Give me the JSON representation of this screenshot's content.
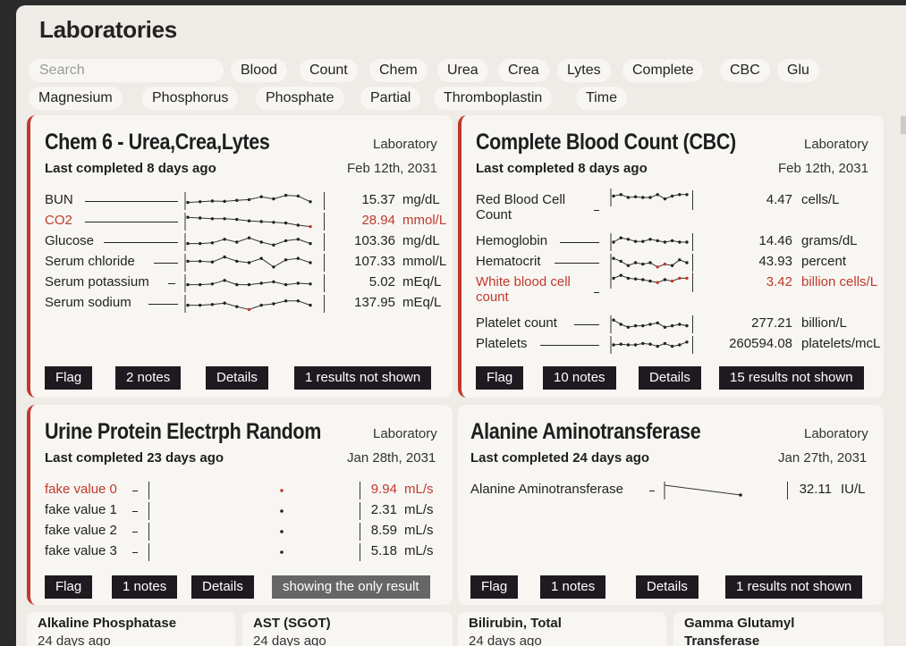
{
  "page": {
    "title": "Laboratories"
  },
  "search": {
    "placeholder": "Search"
  },
  "chips": [
    "Blood",
    "Count",
    "Chem",
    "Urea",
    "Crea",
    "Lytes",
    "Complete",
    "CBC",
    "Glu",
    "Magnesium",
    "Phosphorus",
    "Phosphate",
    "Partial",
    "Thromboplastin",
    "Time"
  ],
  "colors": {
    "accent_red": "#c0392b",
    "button_bg": "#1e1a1f",
    "panel_bg": "#efebe7",
    "card_bg": "#f8f6f3"
  },
  "cards": [
    {
      "title": "Chem 6 - Urea,Crea,Lytes",
      "type": "Laboratory",
      "last_completed": "Last completed 8 days ago",
      "date": "Feb 12th, 2031",
      "flagged": true,
      "results": [
        {
          "label": "BUN",
          "value": "15.37",
          "unit": "mg/dL",
          "abnormal": false,
          "trend": [
            0.6,
            0.55,
            0.5,
            0.52,
            0.45,
            0.4,
            0.2,
            0.35,
            0.1,
            0.15,
            0.55
          ]
        },
        {
          "label": "CO2",
          "value": "28.94",
          "unit": "mmol/L",
          "abnormal": true,
          "trend": [
            0.2,
            0.25,
            0.3,
            0.3,
            0.35,
            0.45,
            0.5,
            0.55,
            0.6,
            0.75,
            0.85
          ]
        },
        {
          "label": "Glucose",
          "value": "103.36",
          "unit": "mg/dL",
          "abnormal": false,
          "trend": [
            0.6,
            0.6,
            0.55,
            0.3,
            0.5,
            0.2,
            0.5,
            0.7,
            0.4,
            0.3,
            0.6
          ]
        },
        {
          "label": "Serum chloride",
          "value": "107.33",
          "unit": "mmol/L",
          "abnormal": false,
          "trend": [
            0.4,
            0.4,
            0.45,
            0.1,
            0.4,
            0.5,
            0.2,
            0.8,
            0.3,
            0.2,
            0.5
          ]
        },
        {
          "label": "Serum potassium",
          "value": "5.02",
          "unit": "mEq/L",
          "abnormal": false,
          "trend": [
            0.6,
            0.6,
            0.55,
            0.3,
            0.6,
            0.6,
            0.5,
            0.4,
            0.6,
            0.5,
            0.55
          ]
        },
        {
          "label": "Serum sodium",
          "value": "137.95",
          "unit": "mEq/L",
          "abnormal": false,
          "trend": [
            0.6,
            0.6,
            0.55,
            0.45,
            0.7,
            0.9,
            0.6,
            0.5,
            0.3,
            0.3,
            0.6
          ]
        }
      ],
      "buttons": {
        "flag": "Flag",
        "notes": "2 notes",
        "details": "Details",
        "more": "1 results not shown"
      }
    },
    {
      "title": "Complete Blood Count (CBC)",
      "type": "Laboratory",
      "last_completed": "Last completed 8 days ago",
      "date": "Feb 12th, 2031",
      "flagged": true,
      "results": [
        {
          "label": "Red Blood Cell Count",
          "value": "4.47",
          "unit": "cells/L",
          "abnormal": false
        },
        {
          "label": "Hemoglobin",
          "value": "14.46",
          "unit": "grams/dL",
          "abnormal": false
        },
        {
          "label": "Hematocrit",
          "value": "43.93",
          "unit": "percent",
          "abnormal": false
        },
        {
          "label": "White blood cell count",
          "value": "3.42",
          "unit": "billion cells/L",
          "abnormal": true
        },
        {
          "label": "Platelet count",
          "value": "277.21",
          "unit": "billion/L",
          "abnormal": false
        },
        {
          "label": "Platelets",
          "value": "260594.08",
          "unit": "platelets/mcL",
          "abnormal": false
        }
      ],
      "buttons": {
        "flag": "Flag",
        "notes": "10 notes",
        "details": "Details",
        "more": "15 results not shown"
      }
    },
    {
      "title": "Urine Protein Electrph Random",
      "type": "Laboratory",
      "last_completed": "Last completed 23 days ago",
      "date": "Jan 28th, 2031",
      "flagged": true,
      "results": [
        {
          "label": "fake value 0",
          "value": "9.94",
          "unit": "mL/s",
          "abnormal": true
        },
        {
          "label": "fake value 1",
          "value": "2.31",
          "unit": "mL/s",
          "abnormal": false
        },
        {
          "label": "fake value 2",
          "value": "8.59",
          "unit": "mL/s",
          "abnormal": false
        },
        {
          "label": "fake value 3",
          "value": "5.18",
          "unit": "mL/s",
          "abnormal": false
        }
      ],
      "buttons": {
        "flag": "Flag",
        "notes": "1 notes",
        "details": "Details",
        "more": "showing the only result"
      }
    },
    {
      "title": "Alanine Aminotransferase",
      "type": "Laboratory",
      "last_completed": "Last completed 24 days ago",
      "date": "Jan 27th, 2031",
      "flagged": false,
      "results": [
        {
          "label": "Alanine Aminotransferase",
          "value": "32.11",
          "unit": "IU/L",
          "abnormal": false
        }
      ],
      "buttons": {
        "flag": "Flag",
        "notes": "1 notes",
        "details": "Details",
        "more": "1 results not shown"
      }
    }
  ],
  "mini_cards": [
    {
      "title": "Alkaline Phosphatase",
      "sub": "24 days ago"
    },
    {
      "title": "AST (SGOT)",
      "sub": "24 days ago"
    },
    {
      "title": "Bilirubin, Total",
      "sub": "24 days ago"
    },
    {
      "title": "Gamma Glutamyl",
      "sub": "Transferase"
    }
  ]
}
